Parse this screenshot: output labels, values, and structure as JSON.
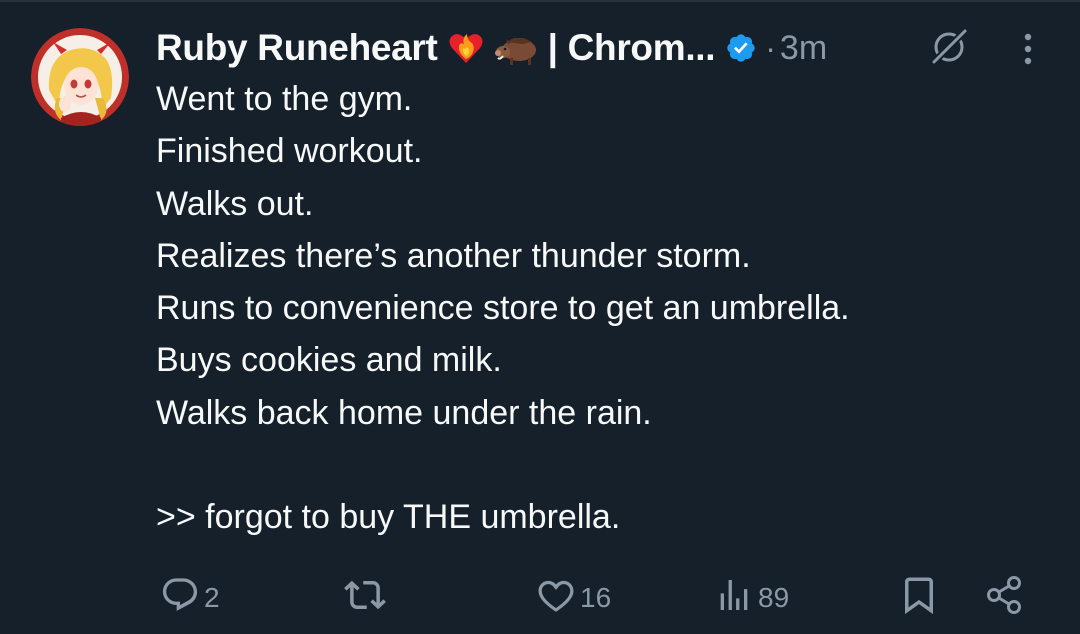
{
  "tweet": {
    "display_name": "Ruby Runeheart",
    "name_suffix": "| Chrom...",
    "dot": "·",
    "timestamp": "3m",
    "lines": [
      "Went to the gym.",
      "Finished workout.",
      "Walks out.",
      "Realizes there’s another thunder storm.",
      "Runs to convenience store to get an umbrella.",
      "Buys cookies and milk.",
      "Walks back home under the rain.",
      "",
      ">> forgot to buy THE umbrella."
    ]
  },
  "icons": {
    "emoji_1": "heart-on-fire-icon",
    "emoji_2": "boar-icon",
    "verified": "verified-badge-icon",
    "grok": "grok-icon",
    "more": "more-options-icon",
    "reply": "reply-icon",
    "retweet": "retweet-icon",
    "like": "like-icon",
    "views": "views-icon",
    "bookmark": "bookmark-icon",
    "share": "share-icon"
  },
  "actions": {
    "reply_count": "2",
    "like_count": "16",
    "views_count": "89"
  },
  "colors": {
    "background": "#15202b",
    "text": "#f7f9f9",
    "muted": "#8b98a5",
    "verified": "#1d9bf0"
  }
}
